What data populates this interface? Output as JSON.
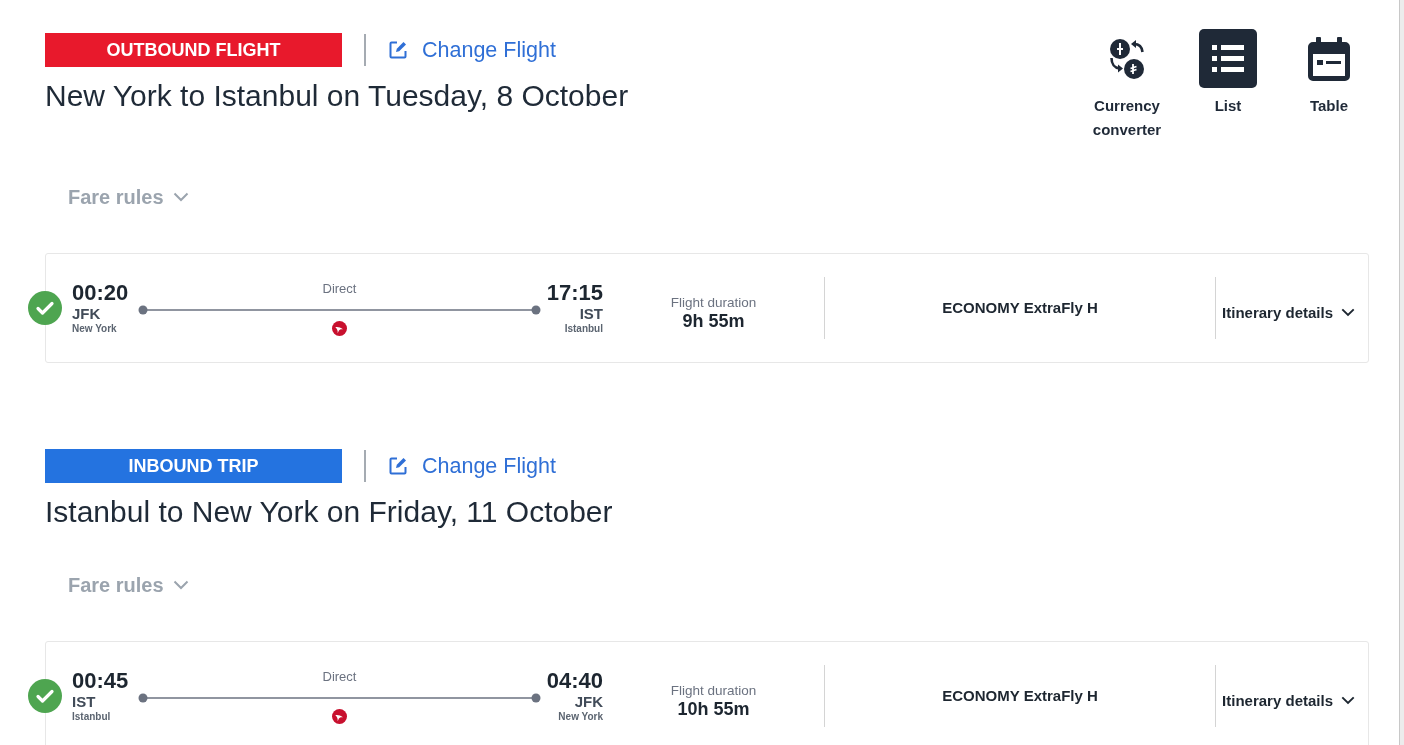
{
  "view_options": [
    {
      "kind": "currency",
      "label": "Currency converter",
      "selected": false
    },
    {
      "kind": "list",
      "label": "List",
      "selected": true
    },
    {
      "kind": "table",
      "label": "Table",
      "selected": false
    }
  ],
  "legs": [
    {
      "badge": "OUTBOUND FLIGHT",
      "color": "#e8192c",
      "change_link": "Change Flight",
      "title": "New York to Istanbul on Tuesday, 8 October",
      "fare_rules": {
        "label": "Fare rules",
        "expanded": false
      },
      "flight": {
        "selected": true,
        "departure": {
          "time": "00:20",
          "code": "JFK",
          "city": "New York"
        },
        "stops": "Direct",
        "arrival": {
          "time": "17:15",
          "code": "IST",
          "city": "Istanbul"
        },
        "duration_label": "Flight duration",
        "duration": "9h 55m",
        "fare_class": "ECONOMY ExtraFly H",
        "details": {
          "label": "Itinerary details",
          "expanded": false
        }
      }
    },
    {
      "badge": "INBOUND TRIP",
      "color": "#2473e0",
      "change_link": "Change Flight",
      "title": "Istanbul to New York on Friday, 11 October",
      "fare_rules": {
        "label": "Fare rules",
        "expanded": false
      },
      "flight": {
        "selected": true,
        "departure": {
          "time": "00:45",
          "code": "IST",
          "city": "Istanbul"
        },
        "stops": "Direct",
        "arrival": {
          "time": "04:40",
          "code": "JFK",
          "city": "New York"
        },
        "duration_label": "Flight duration",
        "duration": "10h 55m",
        "fare_class": "ECONOMY ExtraFly H",
        "details": {
          "label": "Itinerary details",
          "expanded": false
        }
      }
    }
  ]
}
